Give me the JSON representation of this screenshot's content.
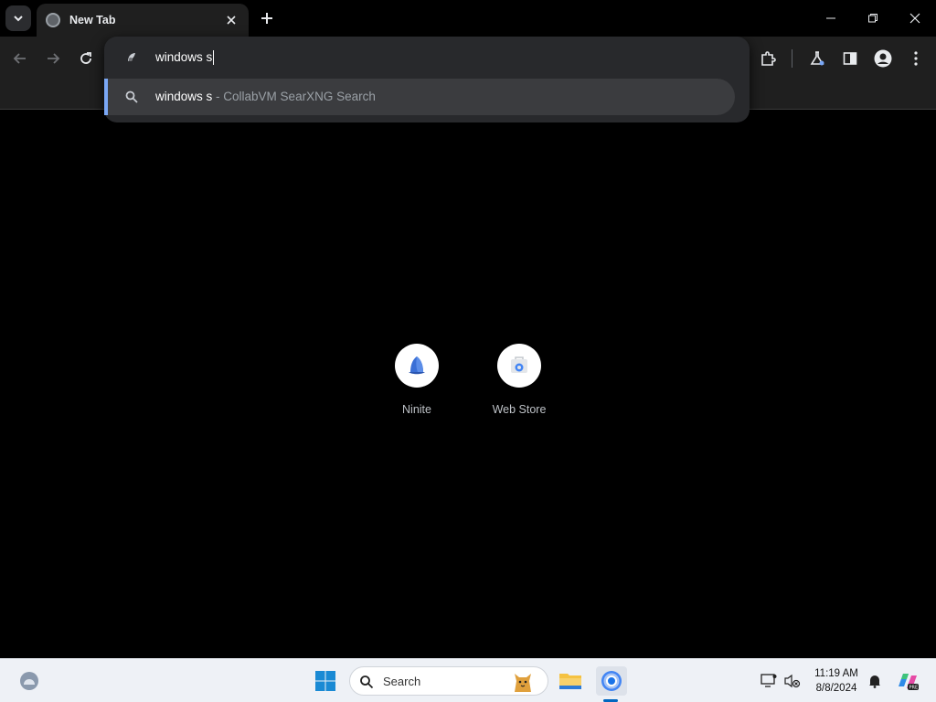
{
  "browser": {
    "tab": {
      "title": "New Tab"
    },
    "omnibox": {
      "typed_text": "windows s",
      "suggestion": {
        "query": "windows s",
        "separator": " - ",
        "engine": "CollabVM SearXNG Search"
      }
    }
  },
  "shortcuts": [
    {
      "label": "Ninite",
      "icon": "ninite-icon"
    },
    {
      "label": "Web Store",
      "icon": "web-store-icon"
    }
  ],
  "taskbar": {
    "search_placeholder": "Search",
    "time": "11:19 AM",
    "date": "8/8/2024"
  },
  "colors": {
    "accent": "#7aa7f5",
    "page_bg": "#000000",
    "toolbar_bg": "#1f1f1f",
    "taskbar_bg": "#eef1f6"
  }
}
